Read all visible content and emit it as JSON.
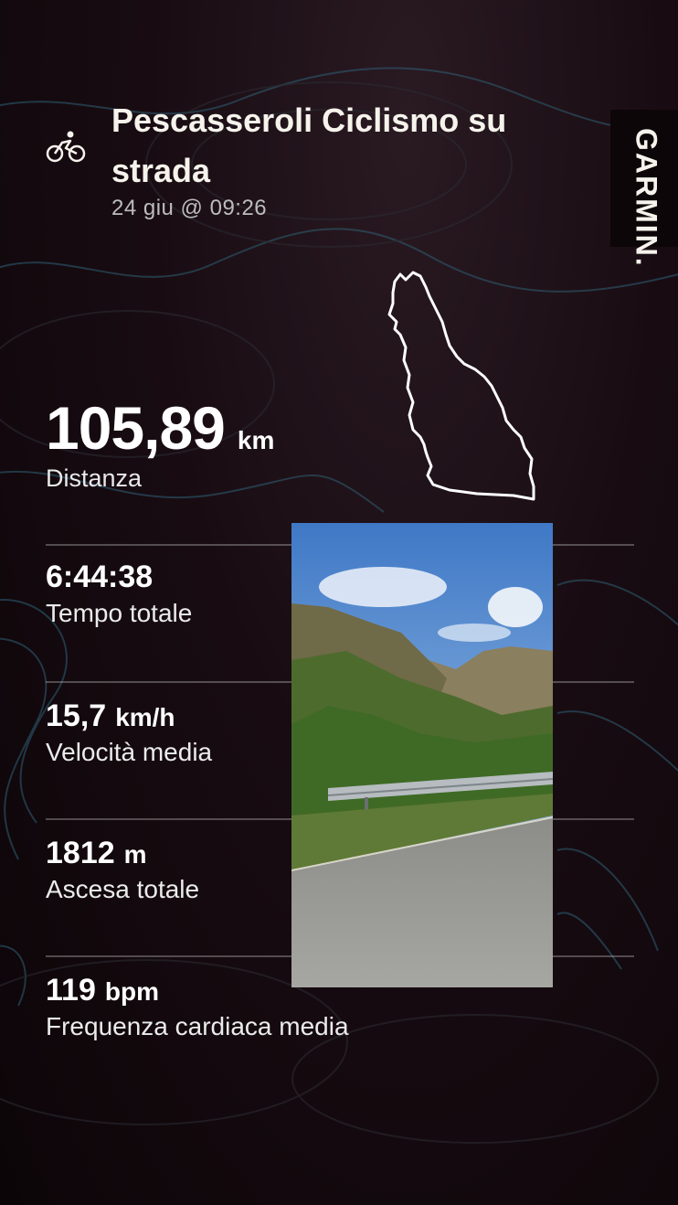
{
  "activity": {
    "icon": "bike-icon",
    "title": "Pescasseroli Ciclismo su strada",
    "date": "24 giu @ 09:26"
  },
  "brand": {
    "logo_text": "GARMIN."
  },
  "distance": {
    "value": "105,89",
    "unit": "km",
    "label": "Distanza"
  },
  "stats": [
    {
      "value": "6:44:38",
      "unit": "",
      "label": "Tempo totale"
    },
    {
      "value": "15,7",
      "unit": "km/h",
      "label": "Velocità media"
    },
    {
      "value": "1812",
      "unit": "m",
      "label": "Ascesa totale"
    },
    {
      "value": "119",
      "unit": "bpm",
      "label": "Frequenza cardiaca media"
    }
  ],
  "colors": {
    "background": "#180c12",
    "contour": "#3a6f86",
    "text": "#f6f3ec"
  }
}
